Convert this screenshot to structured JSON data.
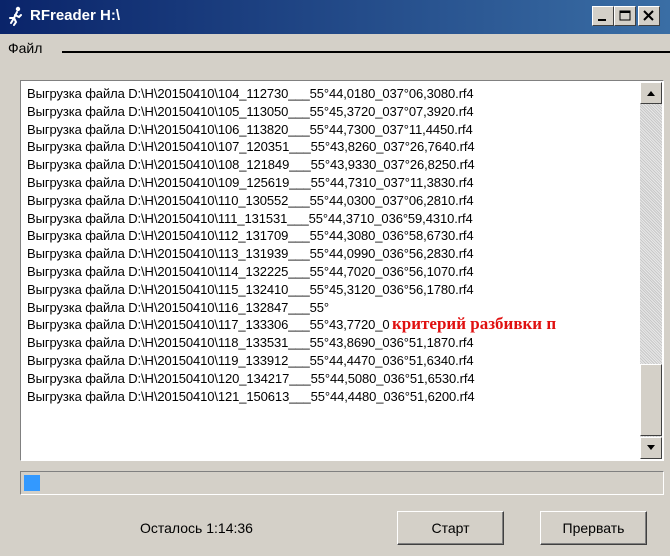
{
  "window": {
    "title": "RFreader  H:\\"
  },
  "menu": {
    "file": "Файл"
  },
  "list": {
    "items": [
      "Выгрузка файла D:\\H\\20150410\\104_112730___55°44,0180_037°06,3080.rf4",
      "Выгрузка файла D:\\H\\20150410\\105_113050___55°45,3720_037°07,3920.rf4",
      "Выгрузка файла D:\\H\\20150410\\106_113820___55°44,7300_037°11,4450.rf4",
      "Выгрузка файла D:\\H\\20150410\\107_120351___55°43,8260_037°26,7640.rf4",
      "Выгрузка файла D:\\H\\20150410\\108_121849___55°43,9330_037°26,8250.rf4",
      "Выгрузка файла D:\\H\\20150410\\109_125619___55°44,7310_037°11,3830.rf4",
      "Выгрузка файла D:\\H\\20150410\\110_130552___55°44,0300_037°06,2810.rf4",
      "Выгрузка файла D:\\H\\20150410\\111_131531___55°44,3710_036°59,4310.rf4",
      "Выгрузка файла D:\\H\\20150410\\112_131709___55°44,3080_036°58,6730.rf4",
      "Выгрузка файла D:\\H\\20150410\\113_131939___55°44,0990_036°56,2830.rf4",
      "Выгрузка файла D:\\H\\20150410\\114_132225___55°44,7020_036°56,1070.rf4",
      "Выгрузка файла D:\\H\\20150410\\115_132410___55°45,3120_036°56,1780.rf4",
      "Выгрузка файла D:\\H\\20150410\\116_132847___55°",
      "Выгрузка файла D:\\H\\20150410\\117_133306___55°43,7720_036°51,5810.rf4",
      "Выгрузка файла D:\\H\\20150410\\118_133531___55°43,8690_036°51,1870.rf4",
      "Выгрузка файла D:\\H\\20150410\\119_133912___55°44,4470_036°51,6340.rf4",
      "Выгрузка файла D:\\H\\20150410\\120_134217___55°44,5080_036°51,6530.rf4",
      "Выгрузка файла D:\\H\\20150410\\121_150613___55°44,4480_036°51,6200.rf4"
    ]
  },
  "overlay_label": "критерий разбивки п",
  "progress": {
    "percent": 2.5
  },
  "status": {
    "remaining": "Осталось 1:14:36"
  },
  "buttons": {
    "start": "Старт",
    "stop": "Прервать"
  },
  "colors": {
    "titlebar": "#0a246a",
    "progress_fill": "#3399ff",
    "overlay_text": "#e01010"
  }
}
